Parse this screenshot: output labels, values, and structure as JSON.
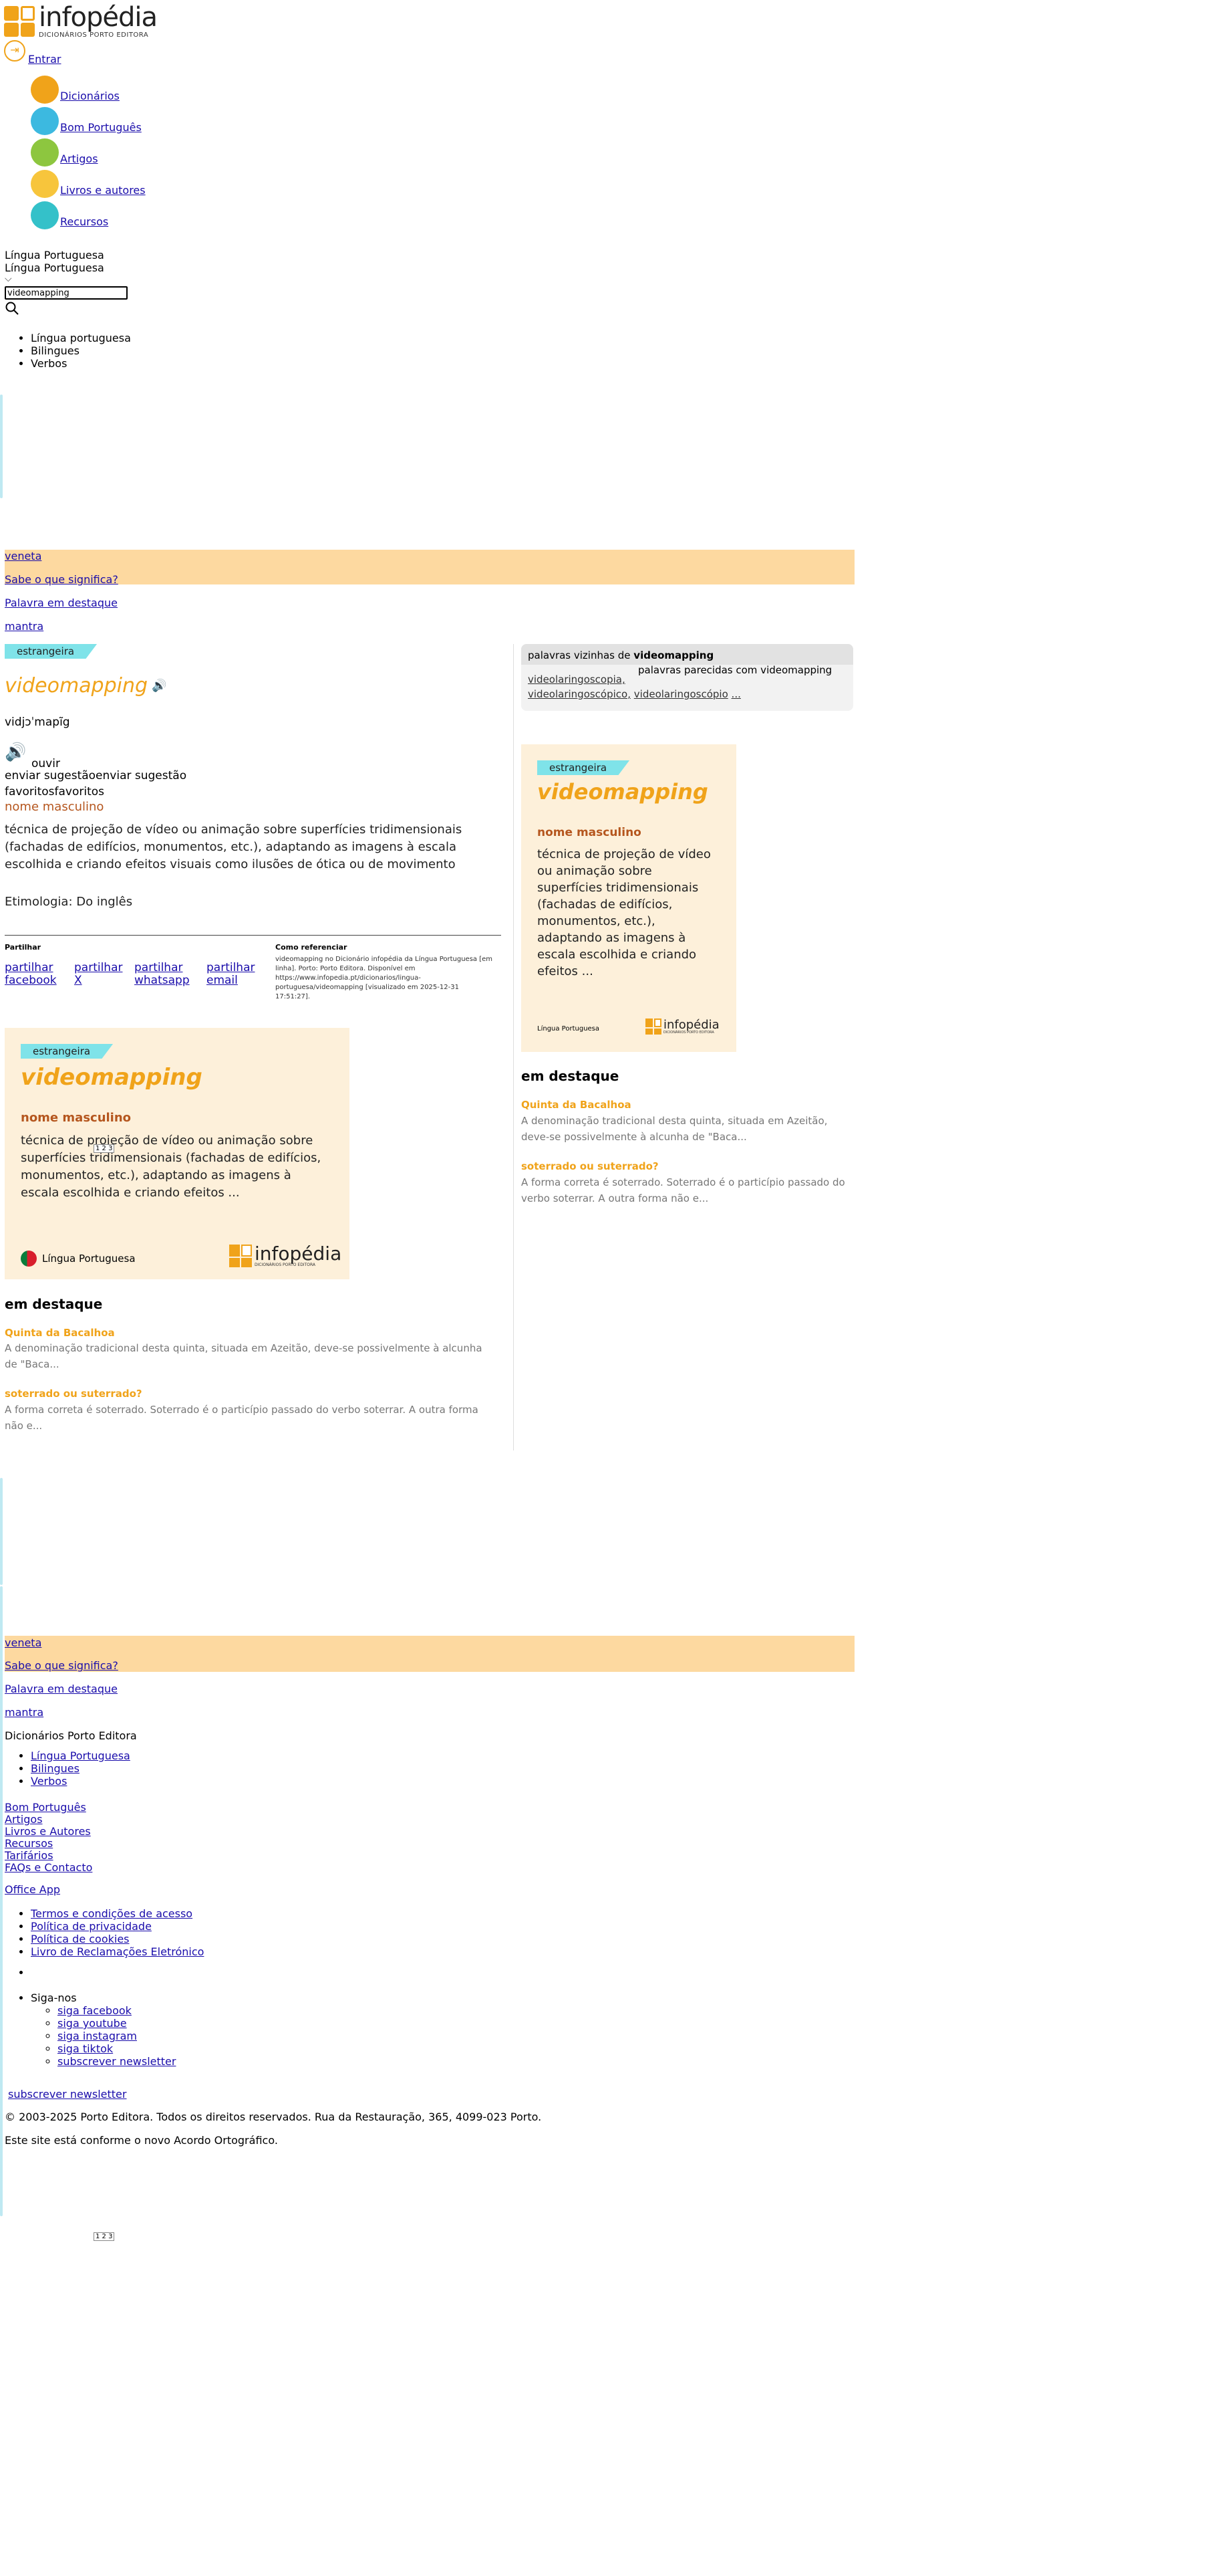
{
  "header": {
    "logo_name": "infopédia",
    "logo_sub": "DICIONÁRIOS PORTO EDITORA",
    "login_label": "Entrar"
  },
  "nav": {
    "items": [
      {
        "label": "Dicionários",
        "color": "#f0a31a"
      },
      {
        "label": "Bom Português",
        "color": "#3cb9e0"
      },
      {
        "label": "Artigos",
        "color": "#8dc63f"
      },
      {
        "label": "Livros e autores",
        "color": "#f7c53c"
      },
      {
        "label": "Recursos",
        "color": "#34c1c9"
      }
    ]
  },
  "search": {
    "dictionary_selected": "Língua Portuguesa",
    "dictionary_selected_2": "Língua Portuguesa",
    "query": "videomapping",
    "options": [
      "Língua portuguesa",
      "Bilingues",
      "Verbos"
    ]
  },
  "promo": {
    "items": [
      "veneta",
      "Sabe o que significa?",
      "Palavra em destaque",
      "mantra"
    ]
  },
  "entry": {
    "tag": "estrangeira",
    "headword": "videomapping",
    "pronunciation": "vidjɔˈmapĩg",
    "listen_label": "ouvir",
    "suggest_label": "enviar sugestãoenviar sugestão",
    "favorites_label": "favoritosfavoritos",
    "pos": "nome masculino",
    "definition": "técnica de projeção de vídeo ou animação sobre superfícies tridimensionais (fachadas de edifícios, monumentos, etc.), adaptando as imagens à escala escolhida e criando efeitos visuais como ilusões de ótica ou de movimento",
    "etymology": "Etimologia: Do inglês"
  },
  "share": {
    "title": "Partilhar",
    "links": [
      "partilhar facebook",
      "partilhar X",
      "partilhar whatsapp",
      "partilhar email"
    ]
  },
  "cite": {
    "title": "Como referenciar",
    "text": "videomapping no Dicionário infopédia da Língua Portuguesa [em linha]. Porto: Porto Editora. Disponível em https://www.infopedia.pt/dicionarios/lingua-portuguesa/videomapping [visualizado em 2025-12-31 17:51:27]."
  },
  "card": {
    "tag": "estrangeira",
    "headword": "videomapping",
    "pos": "nome masculino",
    "definition": "técnica de projeção de vídeo ou animação sobre superfícies tridimensionais (fachadas de edifícios, monumentos, etc.), adaptando as imagens à escala escolhida e criando efeitos ...",
    "language": "Língua Portuguesa",
    "brand": "infopédia",
    "brand_sub": "DICIONÁRIOS PORTO EDITORA",
    "pager": "1 2 3"
  },
  "highlights": {
    "title": "em destaque",
    "items": [
      {
        "title": "Quinta da Bacalhoa",
        "text": "A denominação tradicional desta quinta, situada em Azeitão, deve-se possivelmente à alcunha de \"Baca..."
      },
      {
        "title": "soterrado ou suterrado?",
        "text": "A forma correta é soterrado. Soterrado é o particípio passado do verbo soterrar. A outra forma não e..."
      }
    ]
  },
  "neighbors": {
    "title_prefix": "palavras vizinhas de ",
    "title_word": "videomapping",
    "img_alt": "palavras parecidas com videomapping",
    "words": [
      "videolaringoscopia,",
      "videolaringoscópico,",
      "videolaringoscópio",
      "..."
    ]
  },
  "footer": {
    "brand": "Dicionários Porto Editora",
    "dict_links": [
      "Língua Portuguesa",
      "Bilingues",
      "Verbos"
    ],
    "links": [
      "Bom Português",
      "Artigos",
      "Livros e Autores",
      "Recursos",
      "Tarifários",
      "FAQs e Contacto"
    ],
    "office_app": "Office App",
    "legal": [
      "Termos e condições de acesso",
      "Política de privacidade",
      "Política de cookies",
      "Livro de Reclamações Eletrónico"
    ],
    "follow_label": "Siga-nos",
    "social": [
      "siga facebook",
      "siga youtube",
      "siga instagram",
      "siga tiktok",
      "subscrever newsletter"
    ],
    "newsletter": "subscrever newsletter",
    "copyright": "© 2003-2025 Porto Editora. Todos os direitos reservados. Rua da Restauração, 365, 4099-023 Porto.",
    "agreement": "Este site está conforme o novo Acordo Ortográfico."
  },
  "pager_bottom": "1 2 3"
}
